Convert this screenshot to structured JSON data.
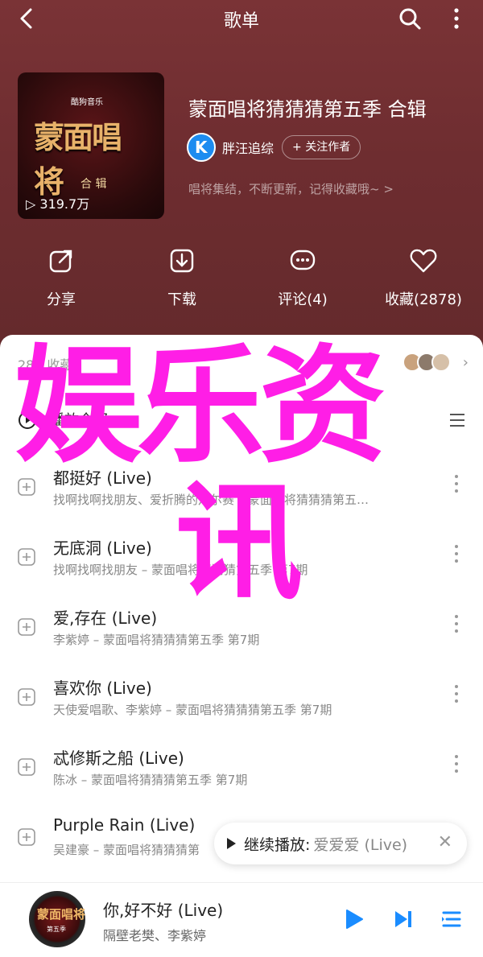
{
  "header": {
    "title": "歌单"
  },
  "album": {
    "cover_badge": "酷狗音乐",
    "cover_logo": "蒙面唱将",
    "cover_sub": "合 辑",
    "play_count": "319.7万",
    "title": "蒙面唱将猜猜猜第五季 合辑",
    "author": "胖汪追综",
    "follow": "+ 关注作者",
    "description": "唱将集结，不断更新，记得收藏哦~ >"
  },
  "actions": [
    {
      "label": "分享"
    },
    {
      "label": "下载"
    },
    {
      "label": "评论(4)"
    },
    {
      "label": "收藏(2878)"
    }
  ],
  "sheet": {
    "collect_text": "28人收藏",
    "play_all": "播放全部"
  },
  "songs": [
    {
      "name": "都挺好 (Live)",
      "meta": "找啊找啊找朋友、爱折腾的凡尔赛 – 蒙面唱将猜猜猜第五…"
    },
    {
      "name": "无底洞 (Live)",
      "meta": "找啊找啊找朋友 – 蒙面唱将猜猜猜第五季 第7期"
    },
    {
      "name": "爱,存在 (Live)",
      "meta": "李紫婷 – 蒙面唱将猜猜猜第五季 第7期"
    },
    {
      "name": "喜欢你 (Live)",
      "meta": "天使爱唱歌、李紫婷 – 蒙面唱将猜猜猜第五季 第7期"
    },
    {
      "name": "忒修斯之船 (Live)",
      "meta": "陈冰 – 蒙面唱将猜猜猜第五季 第7期"
    },
    {
      "name": "Purple Rain (Live)",
      "meta": "吴建豪 – 蒙面唱将猜猜猜第"
    }
  ],
  "watermark": {
    "line1": "娱乐资",
    "line2": "讯"
  },
  "toast": {
    "prefix": "继续播放:",
    "song": "爱爱爱 (Live)"
  },
  "player": {
    "disc_logo": "蒙面唱将",
    "disc_sub": "第五季",
    "title": "你,好不好 (Live)",
    "artist": "隔壁老樊、李紫婷"
  },
  "colors": {
    "hero_bg": "#6e2d30",
    "watermark": "#ff1ee6",
    "player_accent": "#1a8cff"
  }
}
